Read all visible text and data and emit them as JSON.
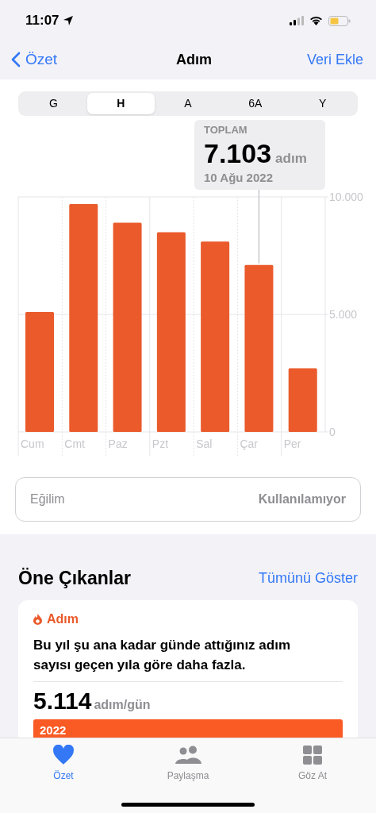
{
  "status_bar": {
    "time": "11:07"
  },
  "nav": {
    "back": "Özet",
    "title": "Adım",
    "action": "Veri Ekle"
  },
  "segments": [
    {
      "label": "G",
      "selected": false
    },
    {
      "label": "H",
      "selected": true
    },
    {
      "label": "A",
      "selected": false
    },
    {
      "label": "6A",
      "selected": false
    },
    {
      "label": "Y",
      "selected": false
    }
  ],
  "tooltip": {
    "heading": "TOPLAM",
    "value": "7.103",
    "unit": "adım",
    "date": "10 Ağu 2022"
  },
  "chart_data": {
    "type": "bar",
    "categories": [
      "Cum",
      "Cmt",
      "Paz",
      "Pzt",
      "Sal",
      "Çar",
      "Per"
    ],
    "series": [
      {
        "color": "#ea5a2b",
        "values": [
          5100,
          9700,
          8900,
          8500,
          8100,
          7103,
          2700
        ]
      }
    ],
    "ylim": [
      0,
      10000
    ],
    "yticks": [
      {
        "value": 0,
        "label": "0"
      },
      {
        "value": 5000,
        "label": "5.000"
      },
      {
        "value": 10000,
        "label": "10.000"
      }
    ]
  },
  "trend": {
    "label": "Eğilim",
    "value": "Kullanılamıyor"
  },
  "highlights": {
    "title": "Öne Çıkanlar",
    "link": "Tümünü Göster",
    "card": {
      "category": "Adım",
      "text": "Bu yıl şu ana kadar günde attığınız adım sayısı geçen yıla göre daha fazla.",
      "value": "5.114",
      "unit": "adım/gün",
      "bar_label": "2022"
    }
  },
  "tab_bar": [
    {
      "label": "Özet",
      "kind": "heart",
      "selected": true
    },
    {
      "label": "Paylaşma",
      "kind": "people",
      "selected": false
    },
    {
      "label": "Göz At",
      "kind": "grid",
      "selected": false
    }
  ]
}
